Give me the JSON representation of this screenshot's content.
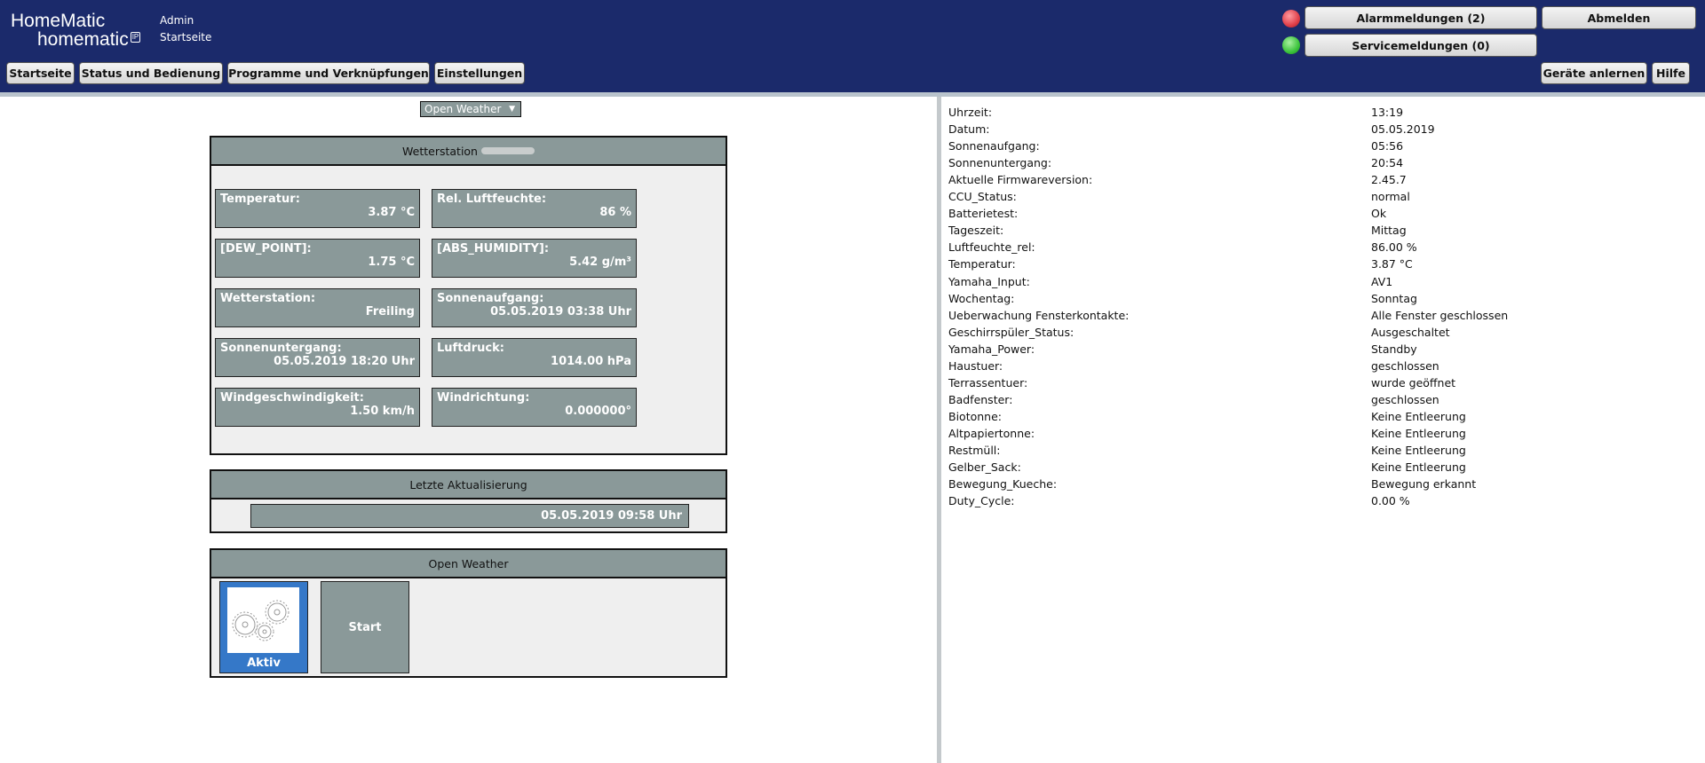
{
  "header": {
    "logo_top": "HomeMatic",
    "logo_bottom": "homematic",
    "logo_badge": "IP",
    "user": "Admin",
    "page": "Startseite",
    "nav": [
      "Startseite",
      "Status und Bedienung",
      "Programme und Verknüpfungen",
      "Einstellungen"
    ],
    "alarm_label": "Alarmmeldungen (2)",
    "service_label": "Servicemeldungen (0)",
    "logout_label": "Abmelden",
    "teach_label": "Geräte anlernen",
    "help_label": "Hilfe",
    "alarm_led_color": "#e0404a",
    "service_led_color": "#3cc43c"
  },
  "main": {
    "selector": "Open Weather",
    "weather_title": "Wetterstation",
    "cells": [
      {
        "label": "Temperatur:",
        "value": "3.87 °C"
      },
      {
        "label": "Rel. Luftfeuchte:",
        "value": "86 %"
      },
      {
        "label": "[DEW_POINT]:",
        "value": "1.75 °C"
      },
      {
        "label": "[ABS_HUMIDITY]:",
        "value": "5.42 g/m³"
      },
      {
        "label": "Wetterstation:",
        "value": "Freiling"
      },
      {
        "label": "Sonnenaufgang:",
        "value": "05.05.2019 03:38 Uhr"
      },
      {
        "label": "Sonnenuntergang:",
        "value": "05.05.2019 18:20 Uhr"
      },
      {
        "label": "Luftdruck:",
        "value": "1014.00 hPa"
      },
      {
        "label": "Windgeschwindigkeit:",
        "value": "1.50 km/h"
      },
      {
        "label": "Windrichtung:",
        "value": "0.000000°"
      }
    ],
    "update_title": "Letzte Aktualisierung",
    "update_value": "05.05.2019 09:58 Uhr",
    "program_title": "Open Weather",
    "active_label": "Aktiv",
    "start_label": "Start"
  },
  "sysvars": [
    {
      "label": "Uhrzeit:",
      "value": "13:19"
    },
    {
      "label": "Datum:",
      "value": "05.05.2019"
    },
    {
      "label": "Sonnenaufgang:",
      "value": "05:56"
    },
    {
      "label": "Sonnenuntergang:",
      "value": "20:54"
    },
    {
      "label": "Aktuelle Firmwareversion:",
      "value": "2.45.7"
    },
    {
      "label": "CCU_Status:",
      "value": "normal"
    },
    {
      "label": "Batterietest:",
      "value": "Ok"
    },
    {
      "label": "Tageszeit:",
      "value": "Mittag"
    },
    {
      "label": "Luftfeuchte_rel:",
      "value": "86.00 %"
    },
    {
      "label": "Temperatur:",
      "value": "3.87 °C"
    },
    {
      "label": "Yamaha_Input:",
      "value": "AV1"
    },
    {
      "label": "Wochentag:",
      "value": "Sonntag"
    },
    {
      "label": "Ueberwachung Fensterkontakte:",
      "value": "Alle Fenster geschlossen"
    },
    {
      "label": "Geschirrspüler_Status:",
      "value": "Ausgeschaltet"
    },
    {
      "label": "Yamaha_Power:",
      "value": "Standby"
    },
    {
      "label": "Haustuer:",
      "value": "geschlossen"
    },
    {
      "label": "Terrassentuer:",
      "value": "wurde geöffnet"
    },
    {
      "label": "Badfenster:",
      "value": "geschlossen"
    },
    {
      "label": "Biotonne:",
      "value": "Keine Entleerung"
    },
    {
      "label": "Altpapiertonne:",
      "value": "Keine Entleerung"
    },
    {
      "label": "Restmüll:",
      "value": "Keine Entleerung"
    },
    {
      "label": "Gelber_Sack:",
      "value": "Keine Entleerung"
    },
    {
      "label": "Bewegung_Kueche:",
      "value": "Bewegung erkannt"
    },
    {
      "label": "Duty_Cycle:",
      "value": "0.00 %"
    }
  ]
}
